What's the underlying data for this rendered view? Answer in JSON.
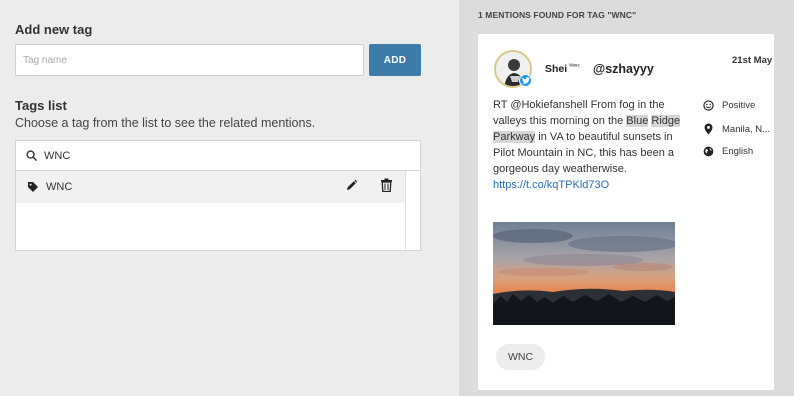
{
  "add_tag": {
    "heading": "Add new tag",
    "input_placeholder": "Tag name",
    "add_label": "ADD"
  },
  "tags_list": {
    "heading": "Tags list",
    "subtitle": "Choose a tag from the list to see the related mentions.",
    "search_value": "WNC",
    "items": [
      {
        "label": "WNC"
      }
    ]
  },
  "mentions": {
    "title": "1 MENTIONS FOUND FOR TAG \"WNC\"",
    "cards": [
      {
        "user_name": "Shei",
        "user_name_suffix": "ᵂᵃᶰᶻ",
        "handle": "@szhayyy",
        "date": "21st May",
        "text_parts": {
          "p1": "RT @Hokiefanshell From fog in the valleys this morning on the ",
          "h1": "Blue",
          "p2": " ",
          "h2": "Ridge",
          "p3": " ",
          "h3": "Parkway",
          "p4": " in VA to beautiful sunsets in Pilot Mountain in NC, this has been a gorgeous day weatherwise."
        },
        "link": "https://t.co/kqTPKld73O",
        "sentiment": "Positive",
        "location": "Manila, N...",
        "language": "English",
        "tag_chip": "WNC"
      }
    ]
  },
  "colors": {
    "accent": "#3d7ca8",
    "link": "#2a6fb5",
    "twitter": "#1d9bf0"
  },
  "icons": [
    "search-icon",
    "tag-icon",
    "pencil-icon",
    "trash-icon",
    "smiley-icon",
    "location-pin-icon",
    "globe-icon",
    "twitter-icon"
  ]
}
